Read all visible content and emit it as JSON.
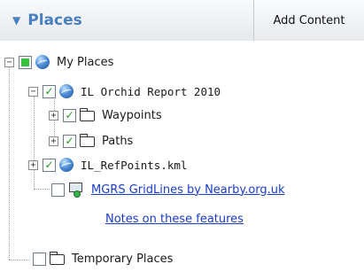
{
  "panel": {
    "title": "Places",
    "add_content_label": "Add Content"
  },
  "tree": {
    "my_places": {
      "label": "My Places"
    },
    "orchid_report": {
      "label": "IL Orchid Report 2010"
    },
    "waypoints": {
      "label": "Waypoints"
    },
    "paths": {
      "label": "Paths"
    },
    "refpoints": {
      "label": "IL_RefPoints.kml"
    },
    "mgrs_gridlines": {
      "label": "MGRS GridLines by Nearby.org.uk"
    },
    "notes_link": {
      "label": "Notes on these features"
    },
    "temporary_places": {
      "label": "Temporary Places"
    }
  }
}
